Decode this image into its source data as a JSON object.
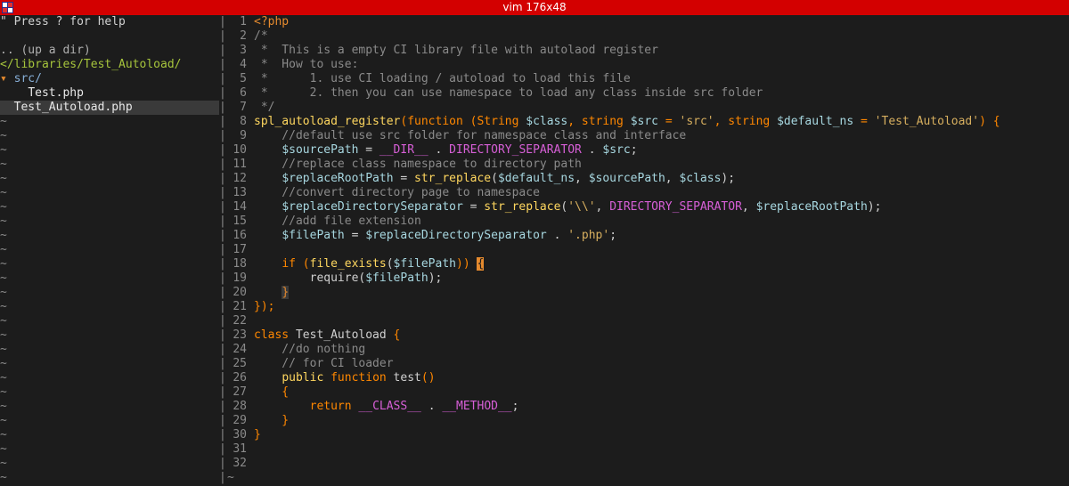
{
  "window": {
    "title": "vim 176x48"
  },
  "tree": {
    "help_text": "\" Press ? for help",
    "blank": "",
    "up_dir": ".. (up a dir)",
    "current_dir": "</libraries/Test_Autoload/",
    "folder_arrow": "▾",
    "folder_name": "src/",
    "file_in_folder": "Test.php",
    "selected_file": "Test_Autoload.php",
    "empty_marker": "~"
  },
  "editor": {
    "separator_char": "|",
    "empty_marker": "~",
    "lines": [
      {
        "n": "1",
        "tokens": [
          {
            "t": "<?php",
            "c": "tag"
          }
        ]
      },
      {
        "n": "2",
        "tokens": [
          {
            "t": "/*",
            "c": "comment"
          }
        ]
      },
      {
        "n": "3",
        "tokens": [
          {
            "t": " *  This is a empty CI library file with autolaod register",
            "c": "comment"
          }
        ]
      },
      {
        "n": "4",
        "tokens": [
          {
            "t": " *  How to use:",
            "c": "comment"
          }
        ]
      },
      {
        "n": "5",
        "tokens": [
          {
            "t": " *      1. use CI loading / autoload to load this file",
            "c": "comment"
          }
        ]
      },
      {
        "n": "6",
        "tokens": [
          {
            "t": " *      2. then you can use namespace to load any class inside src folder",
            "c": "comment"
          }
        ]
      },
      {
        "n": "7",
        "tokens": [
          {
            "t": " */",
            "c": "comment"
          }
        ]
      },
      {
        "n": "8",
        "tokens": [
          {
            "t": "spl_autoload_register",
            "c": "func"
          },
          {
            "t": "(",
            "c": "kw"
          },
          {
            "t": "function",
            "c": "kw"
          },
          {
            "t": " (",
            "c": "kw"
          },
          {
            "t": "String",
            "c": "kw"
          },
          {
            "t": " ",
            "c": "plain"
          },
          {
            "t": "$class",
            "c": "var"
          },
          {
            "t": ", ",
            "c": "kw"
          },
          {
            "t": "string",
            "c": "kw"
          },
          {
            "t": " ",
            "c": "plain"
          },
          {
            "t": "$src",
            "c": "var"
          },
          {
            "t": " = ",
            "c": "kw"
          },
          {
            "t": "'src'",
            "c": "str"
          },
          {
            "t": ", ",
            "c": "kw"
          },
          {
            "t": "string",
            "c": "kw"
          },
          {
            "t": " ",
            "c": "plain"
          },
          {
            "t": "$default_ns",
            "c": "var"
          },
          {
            "t": " = ",
            "c": "kw"
          },
          {
            "t": "'Test_Autoload'",
            "c": "str"
          },
          {
            "t": ") {",
            "c": "kw"
          }
        ]
      },
      {
        "n": "9",
        "tokens": [
          {
            "t": "    //default use src folder for namespace class and interface",
            "c": "comment"
          }
        ]
      },
      {
        "n": "10",
        "tokens": [
          {
            "t": "    ",
            "c": "plain"
          },
          {
            "t": "$sourcePath",
            "c": "var"
          },
          {
            "t": " = ",
            "c": "plain"
          },
          {
            "t": "__DIR__",
            "c": "const"
          },
          {
            "t": " . ",
            "c": "plain"
          },
          {
            "t": "DIRECTORY_SEPARATOR",
            "c": "const"
          },
          {
            "t": " . ",
            "c": "plain"
          },
          {
            "t": "$src",
            "c": "var"
          },
          {
            "t": ";",
            "c": "plain"
          }
        ]
      },
      {
        "n": "11",
        "tokens": [
          {
            "t": "    //replace class namespace to directory path",
            "c": "comment"
          }
        ]
      },
      {
        "n": "12",
        "tokens": [
          {
            "t": "    ",
            "c": "plain"
          },
          {
            "t": "$replaceRootPath",
            "c": "var"
          },
          {
            "t": " = ",
            "c": "plain"
          },
          {
            "t": "str_replace",
            "c": "func"
          },
          {
            "t": "(",
            "c": "plain"
          },
          {
            "t": "$default_ns",
            "c": "var"
          },
          {
            "t": ", ",
            "c": "plain"
          },
          {
            "t": "$sourcePath",
            "c": "var"
          },
          {
            "t": ", ",
            "c": "plain"
          },
          {
            "t": "$class",
            "c": "var"
          },
          {
            "t": ");",
            "c": "plain"
          }
        ]
      },
      {
        "n": "13",
        "tokens": [
          {
            "t": "    //convert directory page to namespace",
            "c": "comment"
          }
        ]
      },
      {
        "n": "14",
        "tokens": [
          {
            "t": "    ",
            "c": "plain"
          },
          {
            "t": "$replaceDirectorySeparator",
            "c": "var"
          },
          {
            "t": " = ",
            "c": "plain"
          },
          {
            "t": "str_replace",
            "c": "func"
          },
          {
            "t": "(",
            "c": "plain"
          },
          {
            "t": "'\\\\'",
            "c": "str"
          },
          {
            "t": ", ",
            "c": "plain"
          },
          {
            "t": "DIRECTORY_SEPARATOR",
            "c": "const"
          },
          {
            "t": ", ",
            "c": "plain"
          },
          {
            "t": "$replaceRootPath",
            "c": "var"
          },
          {
            "t": ");",
            "c": "plain"
          }
        ]
      },
      {
        "n": "15",
        "tokens": [
          {
            "t": "    //add file extension",
            "c": "comment"
          }
        ]
      },
      {
        "n": "16",
        "tokens": [
          {
            "t": "    ",
            "c": "plain"
          },
          {
            "t": "$filePath",
            "c": "var"
          },
          {
            "t": " = ",
            "c": "plain"
          },
          {
            "t": "$replaceDirectorySeparator",
            "c": "var"
          },
          {
            "t": " . ",
            "c": "plain"
          },
          {
            "t": "'.php'",
            "c": "str"
          },
          {
            "t": ";",
            "c": "plain"
          }
        ]
      },
      {
        "n": "17",
        "tokens": []
      },
      {
        "n": "18",
        "tokens": [
          {
            "t": "    ",
            "c": "plain"
          },
          {
            "t": "if",
            "c": "kw"
          },
          {
            "t": " (",
            "c": "kw"
          },
          {
            "t": "file_exists",
            "c": "func"
          },
          {
            "t": "(",
            "c": "plain"
          },
          {
            "t": "$filePath",
            "c": "var"
          },
          {
            "t": ")) ",
            "c": "kw"
          },
          {
            "t": "{",
            "c": "cursor"
          }
        ]
      },
      {
        "n": "19",
        "tokens": [
          {
            "t": "        require(",
            "c": "plain"
          },
          {
            "t": "$filePath",
            "c": "var"
          },
          {
            "t": ");",
            "c": "plain"
          }
        ]
      },
      {
        "n": "20",
        "tokens": [
          {
            "t": "    ",
            "c": "plain"
          },
          {
            "t": "}",
            "c": "match"
          }
        ]
      },
      {
        "n": "21",
        "tokens": [
          {
            "t": "});",
            "c": "kw"
          }
        ]
      },
      {
        "n": "22",
        "tokens": []
      },
      {
        "n": "23",
        "tokens": [
          {
            "t": "class",
            "c": "kw"
          },
          {
            "t": " Test_Autoload ",
            "c": "plain"
          },
          {
            "t": "{",
            "c": "kw"
          }
        ]
      },
      {
        "n": "24",
        "tokens": [
          {
            "t": "    //do nothing",
            "c": "comment"
          }
        ]
      },
      {
        "n": "25",
        "tokens": [
          {
            "t": "    // for CI loader",
            "c": "comment"
          }
        ]
      },
      {
        "n": "26",
        "tokens": [
          {
            "t": "    ",
            "c": "plain"
          },
          {
            "t": "public",
            "c": "func"
          },
          {
            "t": " ",
            "c": "plain"
          },
          {
            "t": "function",
            "c": "kw"
          },
          {
            "t": " test",
            "c": "plain"
          },
          {
            "t": "()",
            "c": "kw"
          }
        ]
      },
      {
        "n": "27",
        "tokens": [
          {
            "t": "    {",
            "c": "kw"
          }
        ]
      },
      {
        "n": "28",
        "tokens": [
          {
            "t": "        ",
            "c": "plain"
          },
          {
            "t": "return",
            "c": "kw"
          },
          {
            "t": " ",
            "c": "plain"
          },
          {
            "t": "__CLASS__",
            "c": "const"
          },
          {
            "t": " . ",
            "c": "plain"
          },
          {
            "t": "__METHOD__",
            "c": "const"
          },
          {
            "t": ";",
            "c": "plain"
          }
        ]
      },
      {
        "n": "29",
        "tokens": [
          {
            "t": "    }",
            "c": "kw"
          }
        ]
      },
      {
        "n": "30",
        "tokens": [
          {
            "t": "}",
            "c": "kw"
          }
        ]
      },
      {
        "n": "31",
        "tokens": []
      },
      {
        "n": "32",
        "tokens": []
      }
    ]
  },
  "colors": {
    "titlebar": "#d30000",
    "background": "#1c1c1c",
    "comment": "#8a8a8a",
    "keyword": "#ff8700",
    "function": "#ffd75f",
    "variable": "#a7d7e0",
    "string": "#d7af5f",
    "constant": "#d75fd7"
  }
}
